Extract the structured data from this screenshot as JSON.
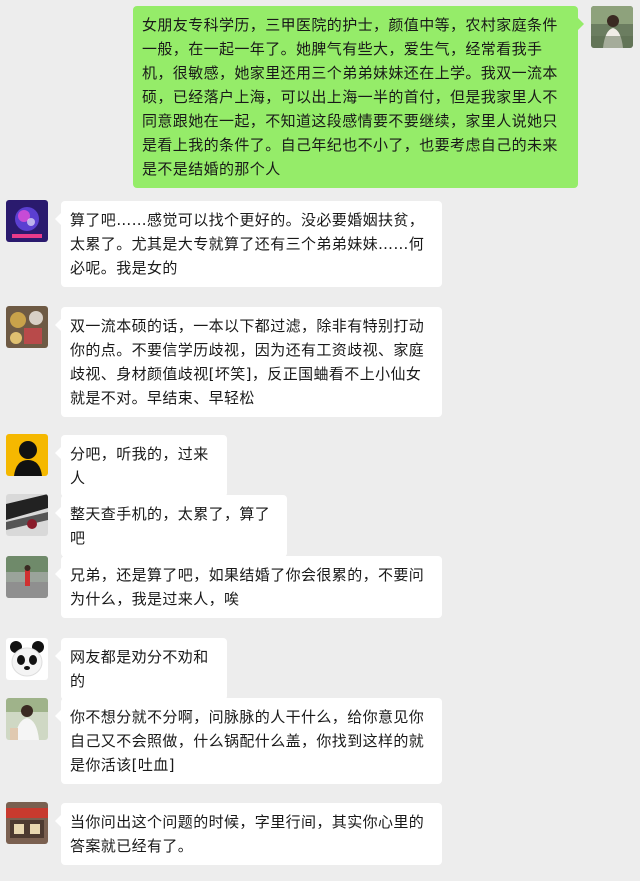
{
  "messages": [
    {
      "sender": "me",
      "text": "女朋友专科学历，三甲医院的护士，颜值中等，农村家庭条件一般，在一起一年了。她脾气有些大，爱生气，经常看我手机，很敏感，她家里还用三个弟弟妹妹还在上学。我双一流本硕，已经落户上海，可以出上海一半的首付，但是我家里人不同意跟她在一起，不知道这段感情要不要继续，家里人说她只是看上我的条件了。自己年纪也不小了，也要考虑自己的未来是不是结婚的那个人"
    },
    {
      "sender": "other",
      "text": "算了吧……感觉可以找个更好的。没必要婚姻扶贫，太累了。尤其是大专就算了还有三个弟弟妹妹……何必呢。我是女的"
    },
    {
      "sender": "other",
      "text": "双一流本硕的话，一本以下都过滤，除非有特别打动你的点。不要信学历歧视，因为还有工资歧视、家庭歧视、身材颜值歧视[坏笑]，反正国蛐看不上小仙女就是不对。早结束、早轻松"
    },
    {
      "sender": "other",
      "text": "分吧，听我的，过来人"
    },
    {
      "sender": "other",
      "text": "整天查手机的，太累了，算了吧"
    },
    {
      "sender": "other",
      "text": "兄弟，还是算了吧，如果结婚了你会很累的，不要问为什么，我是过来人，唉"
    },
    {
      "sender": "other",
      "text": "网友都是劝分不劝和的"
    },
    {
      "sender": "other",
      "text": "你不想分就不分啊，问脉脉的人干什么，给你意见你自己又不会照做，什么锅配什么盖，你找到这样的就是你活该[吐血]"
    },
    {
      "sender": "other",
      "text": "当你问出这个问题的时候，字里行间，其实你心里的答案就已经有了。"
    }
  ],
  "colors": {
    "background": "#ededed",
    "self_bubble": "#95ec69",
    "other_bubble": "#ffffff",
    "text": "#191919"
  },
  "avatars": [
    "user-photo-avatar",
    "galaxy-avatar",
    "toys-avatar",
    "silhouette-avatar",
    "anime-avatar",
    "street-photo-avatar",
    "panda-avatar",
    "person-photo-avatar",
    "storefront-avatar"
  ]
}
